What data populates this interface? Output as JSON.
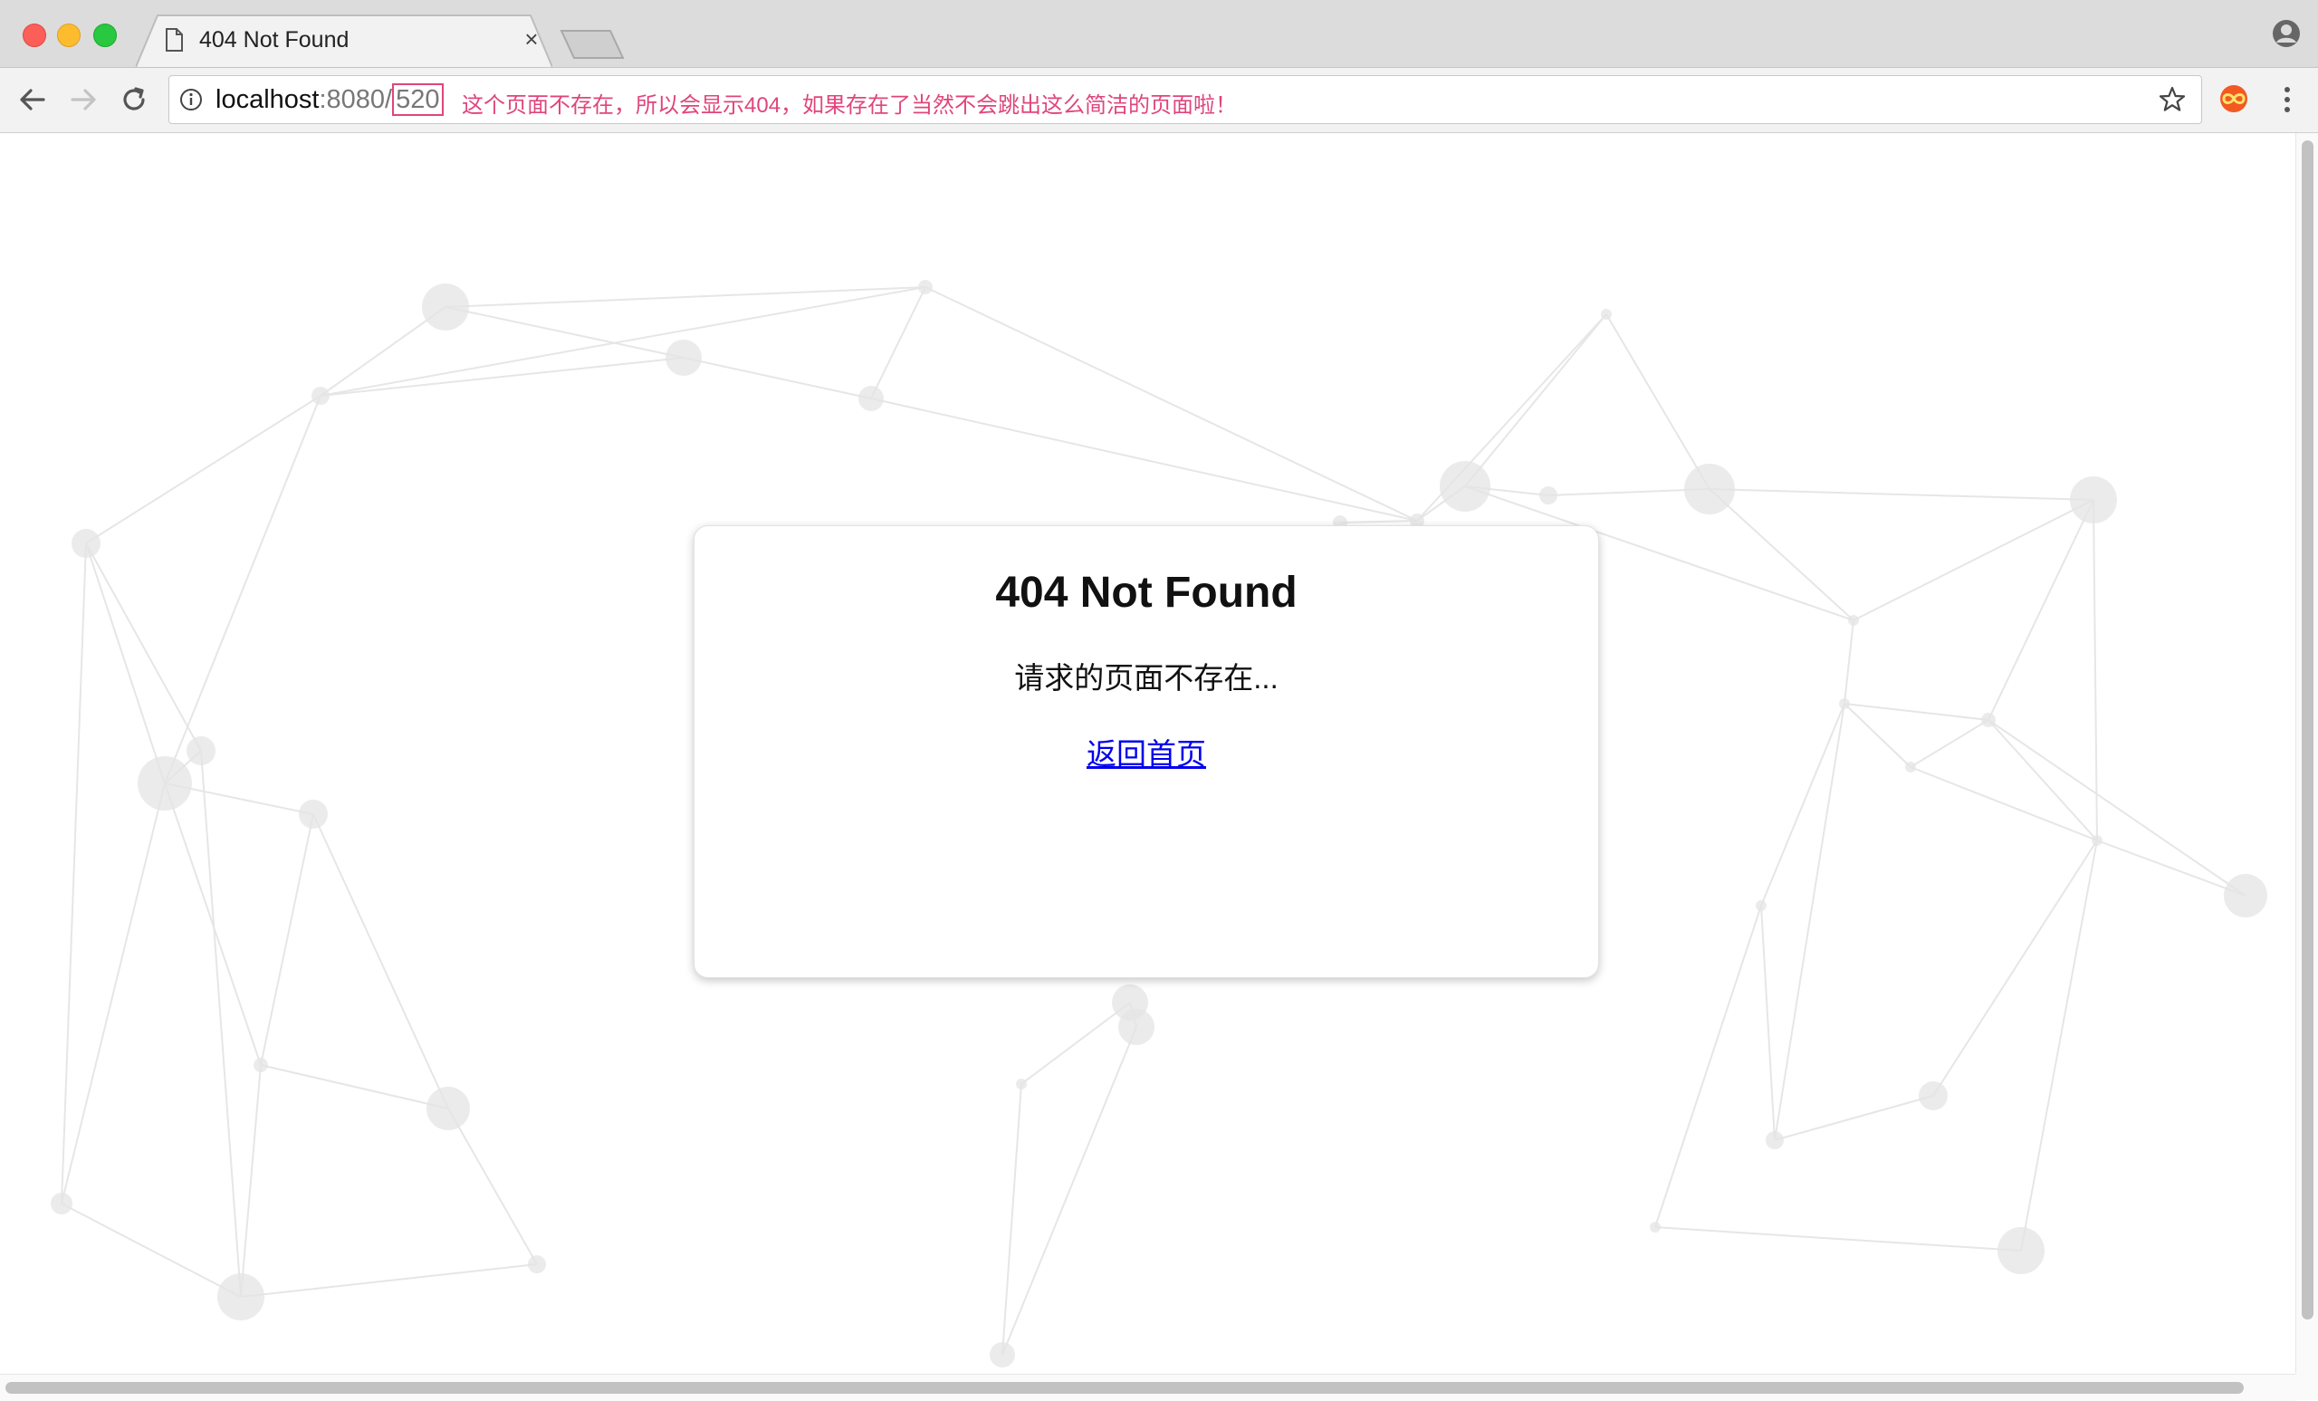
{
  "window": {
    "tab_title": "404 Not Found",
    "tab_close_glyph": "×"
  },
  "address_bar": {
    "host": "localhost",
    "port": ":8080/",
    "path": "520",
    "annotation": "这个页面不存在，所以会显示404，如果存在了当然不会跳出这么简洁的页面啦！"
  },
  "icons": {
    "favicon": "document-icon",
    "back": "back-arrow-icon",
    "forward": "forward-arrow-icon",
    "reload": "reload-icon",
    "site_info": "info-icon",
    "bookmark": "star-icon",
    "extension": "extension-icon",
    "menu": "kebab-menu-icon",
    "profile": "profile-icon"
  },
  "colors": {
    "annotation": "#e0457b",
    "link": "#0000ee",
    "close": "#fc5f57",
    "minimize": "#fdbc2e",
    "maximize": "#28c840"
  },
  "page": {
    "title": "404 Not Found",
    "message": "请求的页面不存在...",
    "home_link": "返回首页"
  }
}
